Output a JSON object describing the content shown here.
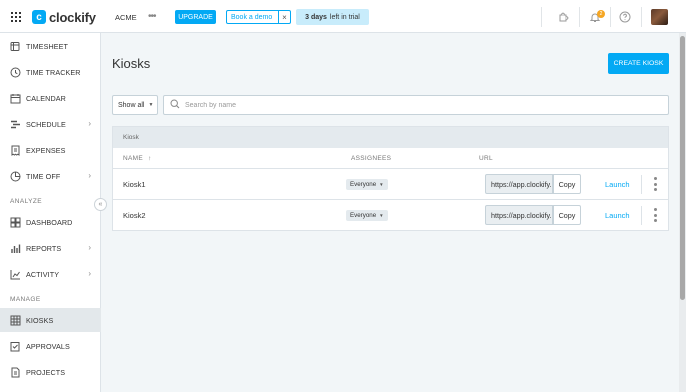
{
  "header": {
    "app_name": "clockify",
    "logo_letter": "c",
    "workspace": "ACME",
    "more_label": "•••",
    "upgrade_label": "UPGRADE",
    "demo_label": "Book a demo",
    "demo_close": "×",
    "trial_days": "3 days",
    "trial_rest": "left in trial",
    "notification_count": "2",
    "icons": [
      "apps-grid-icon",
      "puzzle-icon",
      "bell-icon",
      "help-icon"
    ]
  },
  "sidebar": {
    "items": [
      {
        "label": "TIMESHEET",
        "icon": "timesheet-icon"
      },
      {
        "label": "TIME TRACKER",
        "icon": "clock-icon"
      },
      {
        "label": "CALENDAR",
        "icon": "calendar-icon"
      },
      {
        "label": "SCHEDULE",
        "icon": "schedule-icon",
        "chevron": "›"
      },
      {
        "label": "EXPENSES",
        "icon": "receipt-icon"
      },
      {
        "label": "TIME OFF",
        "icon": "time-off-icon",
        "chevron": "›"
      },
      {
        "label": "DASHBOARD",
        "icon": "dashboard-icon"
      },
      {
        "label": "REPORTS",
        "icon": "reports-icon",
        "chevron": "›"
      },
      {
        "label": "ACTIVITY",
        "icon": "activity-icon",
        "chevron": "›"
      },
      {
        "label": "KIOSKS",
        "icon": "kiosk-icon",
        "active": true
      },
      {
        "label": "APPROVALS",
        "icon": "approvals-icon"
      },
      {
        "label": "PROJECTS",
        "icon": "projects-icon"
      }
    ],
    "section_analyze": "ANALYZE",
    "section_manage": "MANAGE",
    "collapse_label": "«"
  },
  "main": {
    "title": "Kiosks",
    "create_label": "CREATE KIOSK",
    "filter_value": "Show all",
    "search_placeholder": "Search by name",
    "table": {
      "caption": "Kiosk",
      "columns": {
        "name": "NAME",
        "sort_arrow": "↑",
        "assignees": "ASSIGNEES",
        "url": "URL"
      },
      "rows": [
        {
          "name": "Kiosk1",
          "assignees": "Everyone",
          "url": "https://app.clockify.me/kiosk",
          "copy": "Copy",
          "launch": "Launch"
        },
        {
          "name": "Kiosk2",
          "assignees": "Everyone",
          "url": "https://app.clockify.me/kiosk",
          "copy": "Copy",
          "launch": "Launch"
        }
      ]
    }
  },
  "colors": {
    "accent": "#03a9f4",
    "trial_bg": "#c8ecfb",
    "page_bg": "#f2f6f8",
    "badge": "#f5a623"
  }
}
